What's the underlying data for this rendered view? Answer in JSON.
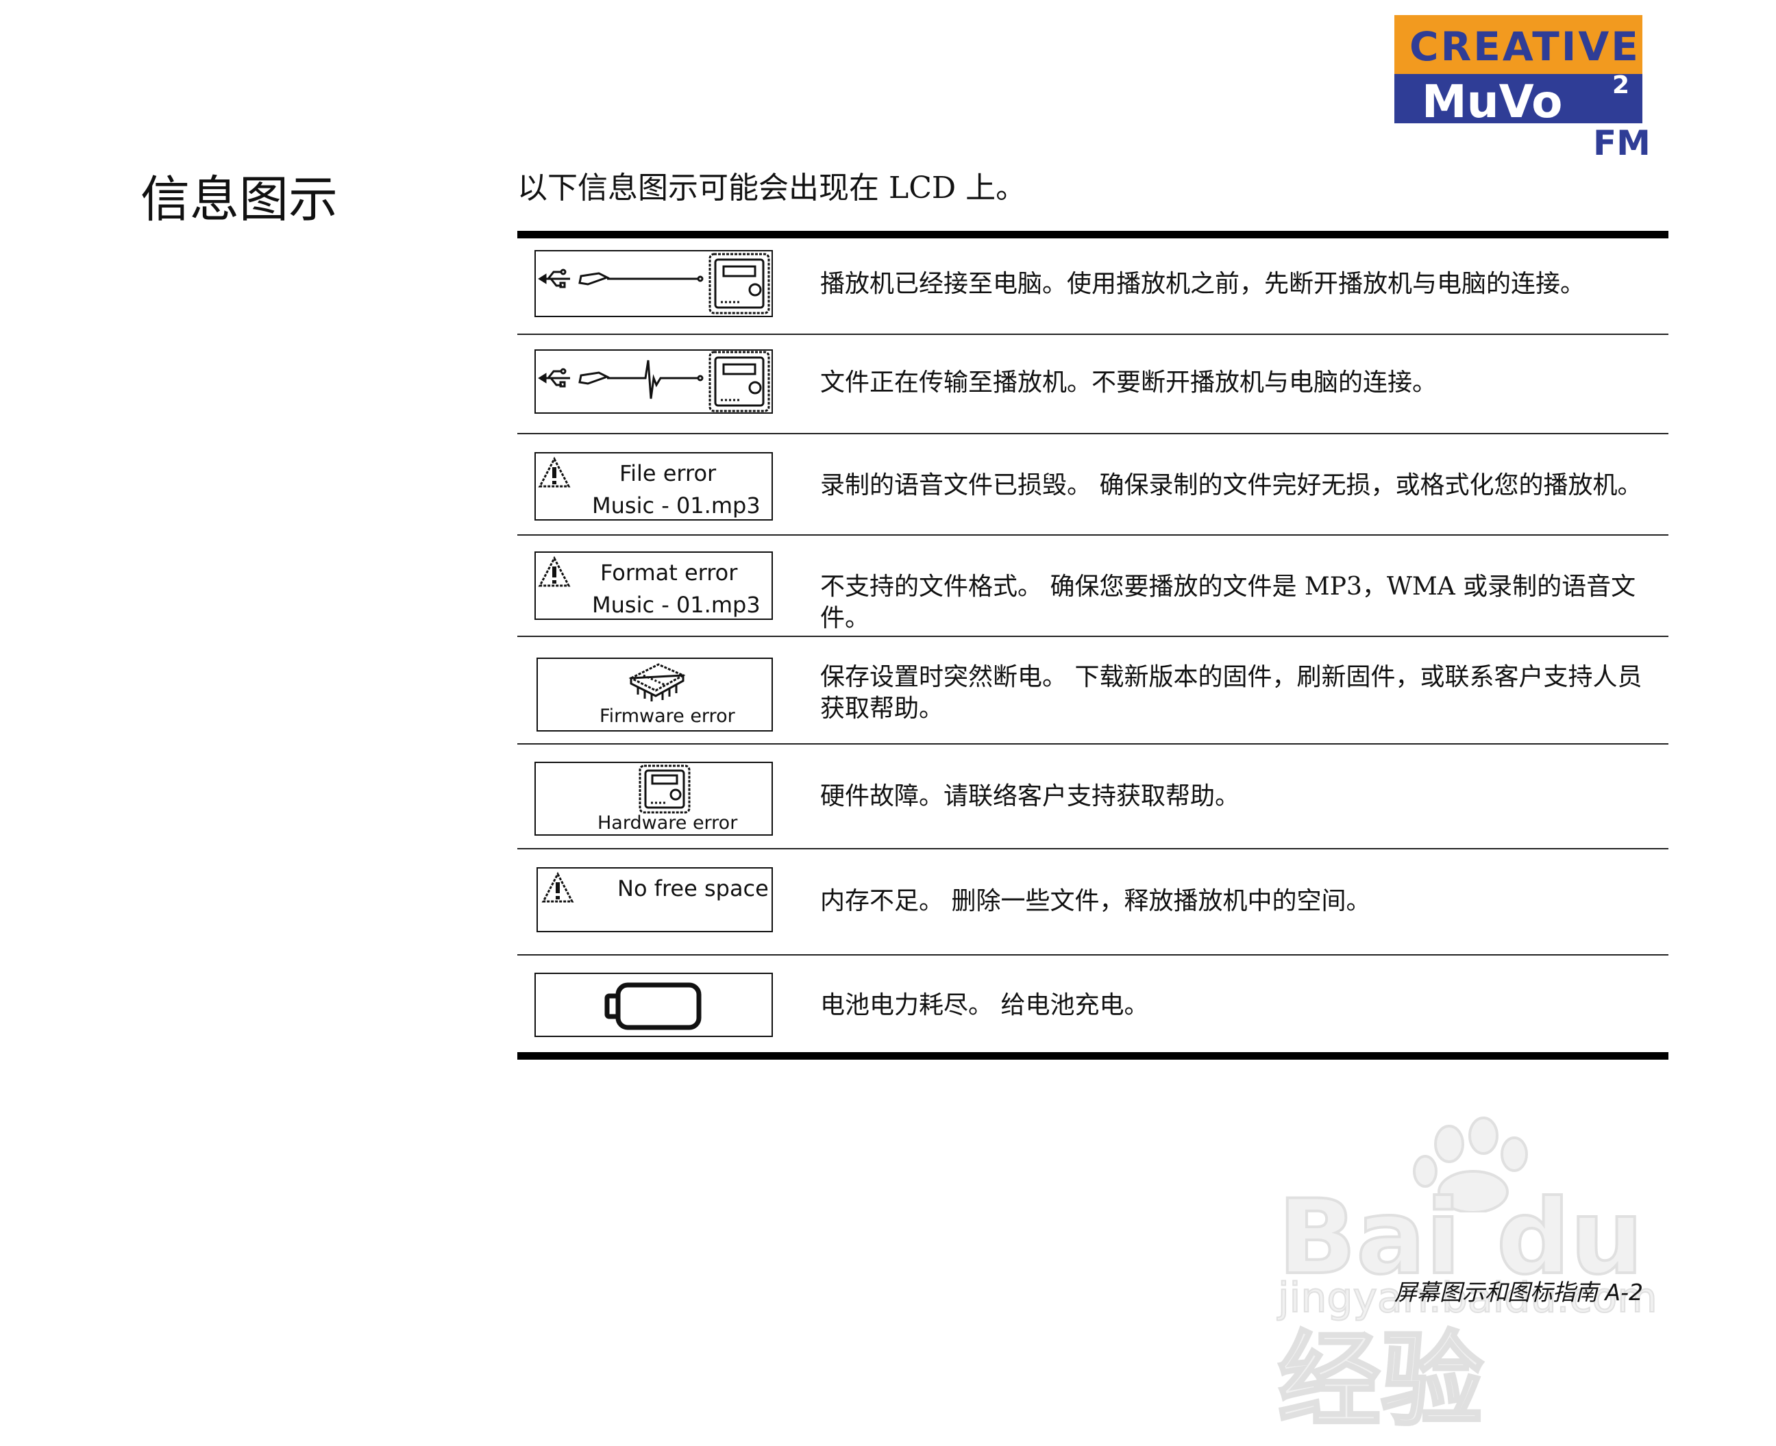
{
  "logo": {
    "brand": "CREATIVE",
    "product": "MuVo",
    "superscript": "2",
    "model": "FM"
  },
  "section_title": "信息图示",
  "intro": "以下信息图示可能会出现在 LCD 上。",
  "rows": [
    {
      "icon": "usb-connected-icon",
      "lcd_line1": "",
      "lcd_line2": "",
      "description": "播放机已经接至电脑。使用播放机之前，先断开播放机与电脑的连接。"
    },
    {
      "icon": "usb-transfer-icon",
      "lcd_line1": "",
      "lcd_line2": "",
      "description": "文件正在传输至播放机。不要断开播放机与电脑的连接。"
    },
    {
      "icon": "warning-icon",
      "lcd_line1": "File error",
      "lcd_line2": "Music - 01.mp3",
      "description": "录制的语音文件已损毁。 确保录制的文件完好无损，或格式化您的播放机。"
    },
    {
      "icon": "warning-icon",
      "lcd_line1": "Format error",
      "lcd_line2": "Music - 01.mp3",
      "description": "不支持的文件格式。 确保您要播放的文件是 MP3，WMA 或录制的语音文件。"
    },
    {
      "icon": "chip-icon",
      "lcd_line1": "Firmware error",
      "lcd_line2": "",
      "description": "保存设置时突然断电。 下载新版本的固件，刷新固件，或联系客户支持人员获取帮助。"
    },
    {
      "icon": "player-icon",
      "lcd_line1": "Hardware error",
      "lcd_line2": "",
      "description": "硬件故障。请联络客户支持获取帮助。"
    },
    {
      "icon": "warning-icon",
      "lcd_line1": "No free space",
      "lcd_line2": "",
      "description": "内存不足。 删除一些文件，释放播放机中的空间。"
    },
    {
      "icon": "battery-empty-icon",
      "lcd_line1": "",
      "lcd_line2": "",
      "description": "电池电力耗尽。 给电池充电。"
    }
  ],
  "watermark": {
    "text": "Bai du 经验",
    "subtext": "jingyan.baidu.com"
  },
  "footer": "屏幕图示和图标指南 A-2"
}
